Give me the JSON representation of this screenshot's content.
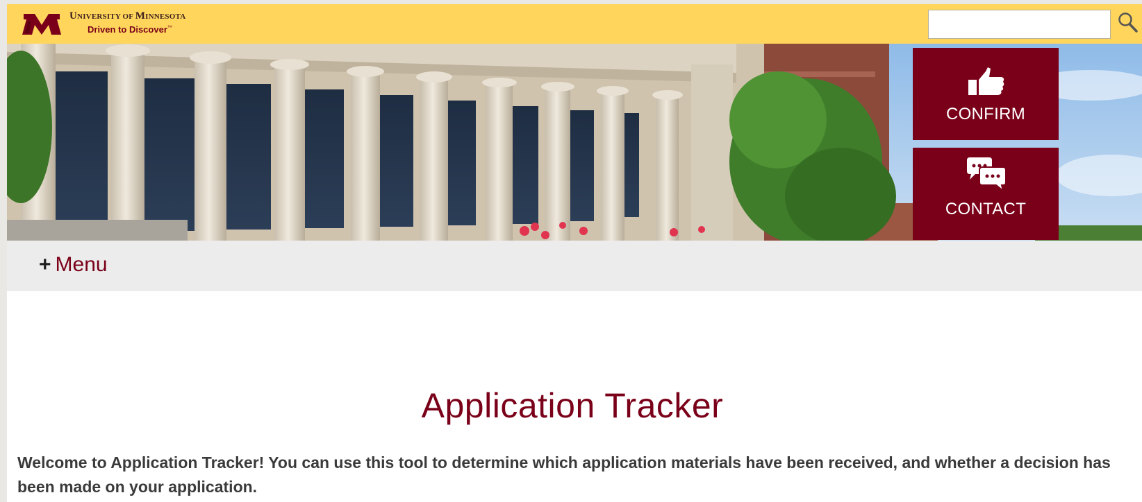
{
  "header": {
    "logo_line1_big1": "U",
    "logo_line1_small1": "NIVERSITY OF ",
    "logo_line1_big2": "M",
    "logo_line1_small2": "INNESOTA",
    "logo_line2": "Driven to Discover",
    "logo_tm": "™",
    "search": {
      "value": "",
      "placeholder": ""
    }
  },
  "hero": {
    "confirm_label": "CONFIRM",
    "contact_label": "CONTACT"
  },
  "menu": {
    "toggle_plus": "+",
    "toggle_label": "Menu"
  },
  "main": {
    "title": "Application Tracker",
    "intro": "Welcome to Application Tracker! You can use this tool to determine which application materials have been received, and whether a decision has been made on your application."
  },
  "colors": {
    "maroon": "#7a0019",
    "gold": "#ffd65b"
  },
  "icons": {
    "logo": "block-m-logo",
    "search": "magnifier-icon",
    "confirm": "thumbs-up-icon",
    "contact": "chat-bubbles-icon"
  }
}
